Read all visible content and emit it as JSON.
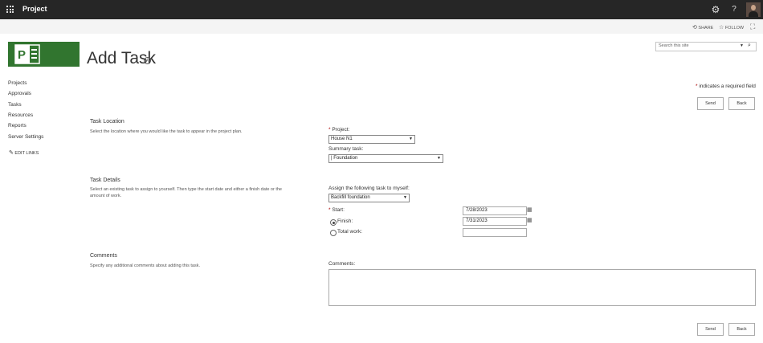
{
  "app": {
    "title": "Project"
  },
  "topbar": {
    "waffle_icon": "waffle-icon",
    "settings_icon": "gear-icon",
    "help_icon": "help-icon"
  },
  "suitebar": {
    "share_label": "SHARE",
    "follow_label": "FOLLOW",
    "focus_icon": "focus-mode-icon"
  },
  "page": {
    "title": "Add Task",
    "info_glyph": "i"
  },
  "search": {
    "placeholder": "Search this site"
  },
  "nav": {
    "items": [
      {
        "label": "Projects"
      },
      {
        "label": "Approvals"
      },
      {
        "label": "Tasks"
      },
      {
        "label": "Resources"
      },
      {
        "label": "Reports"
      },
      {
        "label": "Server Settings"
      }
    ],
    "edit_links": "EDIT LINKS"
  },
  "form": {
    "required_note": "indicates a required field",
    "required_star": "*",
    "send_label": "Send",
    "back_label": "Back",
    "task_location": {
      "heading": "Task Location",
      "description": "Select the location where you would like the task to appear in the project plan.",
      "project_label": "Project:",
      "project_value": "House N1",
      "summary_label": "Summary task:",
      "summary_value": "| Foundation"
    },
    "task_details": {
      "heading": "Task Details",
      "description": "Select an existing task to assign to yourself. Then type the start date and either a finish date or the amount of work.",
      "assign_label": "Assign the following task to myself:",
      "assign_value": "Backfill foundation",
      "start_label": "Start:",
      "start_value": "7/28/2023",
      "finish_label": "Finish:",
      "finish_value": "7/31/2023",
      "total_work_label": "Total work:",
      "total_work_value": ""
    },
    "comments": {
      "heading": "Comments",
      "description": "Specify any additional comments about adding this task.",
      "label": "Comments:"
    }
  },
  "colors": {
    "topbar": "#262626",
    "logo_bg": "#31752f",
    "required_star": "#a00000"
  }
}
